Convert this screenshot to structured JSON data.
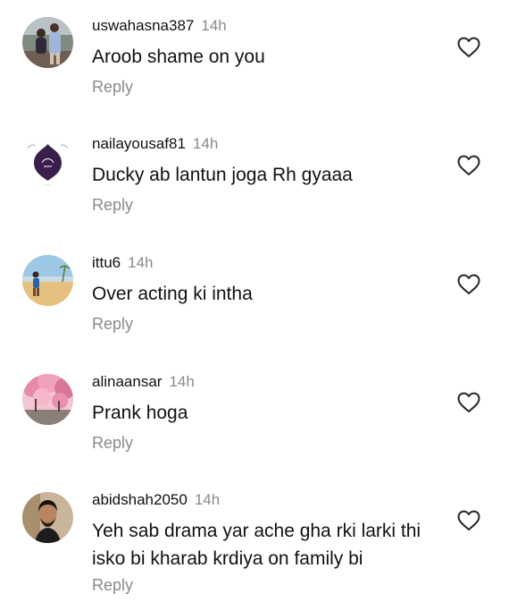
{
  "reply_label": "Reply",
  "comments": [
    {
      "username": "uswahasna387",
      "time": "14h",
      "text": "Aroob shame on you",
      "avatar": "photo-two-children-icon"
    },
    {
      "username": "nailayousaf81",
      "time": "14h",
      "text": "Ducky ab lantun joga Rh gyaaa",
      "avatar": "purple-lantern-logo-icon"
    },
    {
      "username": "ittu6",
      "time": "14h",
      "text": "Over acting ki intha",
      "avatar": "photo-child-on-beach-icon"
    },
    {
      "username": "alinaansar",
      "time": "14h",
      "text": "Prank hoga",
      "avatar": "photo-pink-blossom-trees-icon"
    },
    {
      "username": "abidshah2050",
      "time": "14h",
      "text": "Yeh sab drama yar ache gha rki larki thi isko bi kharab krdiya on family bi",
      "avatar": "photo-man-portrait-icon"
    }
  ],
  "icons": {
    "like": "heart-outline-icon"
  },
  "colors": {
    "text": "#111111",
    "secondary": "#8a8a8a",
    "background": "#ffffff"
  }
}
